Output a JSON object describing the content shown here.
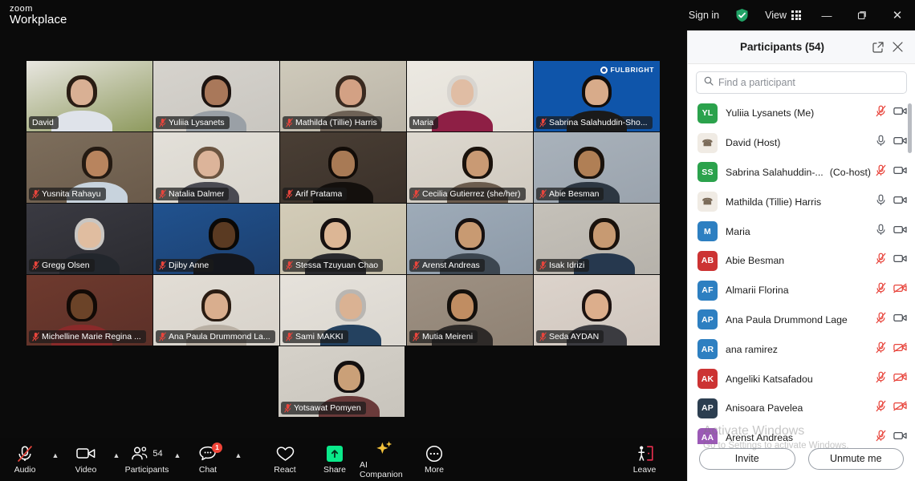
{
  "titlebar": {
    "brand_top": "zoom",
    "brand_bottom": "Workplace",
    "signin": "Sign in",
    "shield_icon": "shield-check-icon",
    "view_label": "View",
    "view_icon": "grid-icon",
    "minimize_icon": "minimize-icon",
    "restore_icon": "restore-icon",
    "close_icon": "close-icon"
  },
  "gallery": {
    "active_speaker": "David",
    "tiles": [
      {
        "name": "David",
        "muted": false,
        "active": true,
        "bg": "#8e9a5e",
        "wall": "#e8e6e0",
        "skin": "#d9b094",
        "hair": "#2a1d14",
        "shirt": "#dfe3ea",
        "chair": "#2b2b2b"
      },
      {
        "name": "Yuliia Lysanets",
        "muted": true,
        "bg": "#c9c6c0",
        "wall": "#d6d3cd",
        "skin": "#a9785a",
        "hair": "#1c1310",
        "shirt": "#9aa0a6",
        "chair": ""
      },
      {
        "name": "Mathilda (Tillie) Harris",
        "muted": true,
        "bg": "#b9b3a6",
        "wall": "#cfcabb",
        "skin": "#d3a184",
        "hair": "#3a2a20",
        "shirt": "#6e6256",
        "chair": ""
      },
      {
        "name": "Maria",
        "muted": false,
        "bg": "#e2ded6",
        "wall": "#ece9e2",
        "skin": "#e0bda4",
        "hair": "#d8d5d0",
        "shirt": "#8e1f45",
        "chair": "#2e2a28"
      },
      {
        "name": "Sabrina Salahuddin-Sho...",
        "muted": true,
        "watermark": "FULBRIGHT",
        "bg": "#0f55aa",
        "wall": "#0f55aa",
        "skin": "#d8ab8a",
        "hair": "#120d0a",
        "shirt": "#1a1a1a",
        "chair": ""
      },
      {
        "name": "Yusnita Rahayu",
        "muted": true,
        "bg": "#6a5a4a",
        "wall": "#7d6e5c",
        "skin": "#b8845e",
        "hair": "#241a12",
        "shirt": "#c8d3dd",
        "chair": ""
      },
      {
        "name": "Natalia Dalmer",
        "muted": true,
        "bg": "#d8d4cc",
        "wall": "#e3e0d9",
        "skin": "#dcb49a",
        "hair": "#6b5440",
        "shirt": "#4a4a52",
        "chair": ""
      },
      {
        "name": "Arif Pratama",
        "muted": true,
        "bg": "#3a3029",
        "wall": "#4a3f35",
        "skin": "#a87a55",
        "hair": "#120c08",
        "shirt": "#14100d",
        "chair": ""
      },
      {
        "name": "Cecilia Gutierrez (she/her)",
        "muted": true,
        "bg": "#cfc9bf",
        "wall": "#ddd8cf",
        "skin": "#c99a74",
        "hair": "#1a120c",
        "shirt": "#6b5c4e",
        "chair": ""
      },
      {
        "name": "Abie Besman",
        "muted": true,
        "bg": "#9aa3ad",
        "wall": "#a9b2bb",
        "skin": "#b07f55",
        "hair": "#1a120c",
        "shirt": "#2d3742",
        "chair": ""
      },
      {
        "name": "Gregg Olsen",
        "muted": true,
        "bg": "#2b2b30",
        "wall": "#3a3a42",
        "skin": "#e0bda0",
        "hair": "#c9c6c2",
        "shirt": "#22262c",
        "chair": ""
      },
      {
        "name": "Djiby Anne",
        "muted": true,
        "bg": "#1d3f6e",
        "wall": "#20528f",
        "skin": "#5a3a22",
        "hair": "#0a0806",
        "shirt": "#14161c",
        "chair": ""
      },
      {
        "name": "Stessa Tzuyuan Chao",
        "muted": true,
        "bg": "#c4bda8",
        "wall": "#d3ccb8",
        "skin": "#dcb695",
        "hair": "#161010",
        "shirt": "#2a2a2e",
        "chair": ""
      },
      {
        "name": "Arenst Andreas",
        "muted": true,
        "bg": "#8d9aa8",
        "wall": "#9eabb8",
        "skin": "#c89a72",
        "hair": "#161010",
        "shirt": "#3c4650",
        "chair": ""
      },
      {
        "name": "Isak Idrizi",
        "muted": true,
        "bg": "#b6b2ab",
        "wall": "#c5c1b9",
        "skin": "#c79a72",
        "hair": "#1a120c",
        "shirt": "#26384e",
        "chair": ""
      },
      {
        "name": "Michelline Marie Regina ...",
        "muted": true,
        "bg": "#5c3028",
        "wall": "#6e3a2e",
        "skin": "#6b4328",
        "hair": "#120a06",
        "shirt": "#8a2a2a",
        "chair": ""
      },
      {
        "name": "Ana Paula Drummond La...",
        "muted": true,
        "bg": "#d7d2ca",
        "wall": "#e2ddd5",
        "skin": "#d9ae8e",
        "hair": "#2a1c12",
        "shirt": "#b9b0a4",
        "chair": ""
      },
      {
        "name": "Sami MAKKI",
        "muted": true,
        "bg": "#dad6cf",
        "wall": "#e6e2db",
        "skin": "#dab293",
        "hair": "#b9b6b2",
        "shirt": "#24415f",
        "chair": ""
      },
      {
        "name": "Mutia Meireni",
        "muted": true,
        "bg": "#8f8274",
        "wall": "#9e9183",
        "skin": "#c08d62",
        "hair": "#14100c",
        "shirt": "#2e2a28",
        "chair": ""
      },
      {
        "name": "Seda AYDAN",
        "muted": true,
        "bg": "#cfc6be",
        "wall": "#dcd3cb",
        "skin": "#dcae8c",
        "hair": "#1c1210",
        "shirt": "#3b3b40",
        "chair": ""
      },
      {
        "name": "Yotsawat Pomyen",
        "muted": true,
        "bg": "#c8c4bc",
        "wall": "#d5d1c9",
        "skin": "#caa078",
        "hair": "#141010",
        "shirt": "#6a3a3a",
        "chair": ""
      }
    ]
  },
  "toolbar": {
    "items": [
      {
        "name": "audio",
        "label": "Audio",
        "icon": "microphone-muted-icon",
        "muted": true,
        "caret": true
      },
      {
        "name": "video",
        "label": "Video",
        "icon": "camera-icon",
        "caret": true
      },
      {
        "name": "participants",
        "label": "Participants",
        "icon": "participants-icon",
        "count": "54",
        "caret": true
      },
      {
        "name": "chat",
        "label": "Chat",
        "icon": "chat-icon",
        "badge": "1",
        "caret": true
      },
      {
        "name": "react",
        "label": "React",
        "icon": "heart-icon"
      },
      {
        "name": "share",
        "label": "Share",
        "icon": "share-screen-icon"
      },
      {
        "name": "ai-companion",
        "label": "AI Companion",
        "icon": "sparkles-icon"
      },
      {
        "name": "more",
        "label": "More",
        "icon": "ellipsis-icon"
      },
      {
        "name": "leave",
        "label": "Leave",
        "icon": "leave-door-icon"
      }
    ]
  },
  "participants_panel": {
    "title": "Participants (54)",
    "popout_icon": "popout-icon",
    "close_icon": "close-icon",
    "search_placeholder": "Find a participant",
    "search_value": "",
    "search_icon": "search-icon",
    "invite_label": "Invite",
    "unmute_label": "Unmute me",
    "rows": [
      {
        "initials": "YL",
        "color": "#2ba24c",
        "name": "Yuliia Lysanets (Me)",
        "role": "",
        "mic": "muted",
        "cam": "on"
      },
      {
        "initials": "",
        "color": "phone",
        "name": "David (Host)",
        "role": "",
        "mic": "on",
        "cam": "on"
      },
      {
        "initials": "SS",
        "color": "#2ba24c",
        "name": "Sabrina Salahuddin-...",
        "role": "(Co-host)",
        "mic": "muted",
        "cam": "on"
      },
      {
        "initials": "",
        "color": "phone",
        "name": "Mathilda (Tillie) Harris",
        "role": "",
        "mic": "on",
        "cam": "on"
      },
      {
        "initials": "M",
        "color": "#2d7fc1",
        "name": "Maria",
        "role": "",
        "mic": "on",
        "cam": "on"
      },
      {
        "initials": "AB",
        "color": "#cc3333",
        "name": "Abie Besman",
        "role": "",
        "mic": "muted",
        "cam": "on"
      },
      {
        "initials": "AF",
        "color": "#2d7fc1",
        "name": "Almarii Florina",
        "role": "",
        "mic": "muted",
        "cam": "off"
      },
      {
        "initials": "AP",
        "color": "#2d7fc1",
        "name": "Ana Paula Drummond Lage",
        "role": "",
        "mic": "muted",
        "cam": "on"
      },
      {
        "initials": "AR",
        "color": "#2d7fc1",
        "name": "ana ramirez",
        "role": "",
        "mic": "muted",
        "cam": "off"
      },
      {
        "initials": "AK",
        "color": "#cc3333",
        "name": "Angeliki Katsafadou",
        "role": "",
        "mic": "muted",
        "cam": "off"
      },
      {
        "initials": "AP",
        "color": "#2c3e50",
        "name": "Anisoara Pavelea",
        "role": "",
        "mic": "muted",
        "cam": "off"
      },
      {
        "initials": "AA",
        "color": "#9b59b6",
        "name": "Arenst Andreas",
        "role": "",
        "mic": "muted",
        "cam": "on"
      }
    ]
  },
  "watermark": {
    "line1": "Activate Windows",
    "line2": "Go to Settings to activate Windows."
  },
  "colors": {
    "accent_green": "#0ae98a",
    "active_border": "#3bd47a",
    "mute_red": "#e8453c",
    "badge_red": "#f04438",
    "leave_red": "#f05a5a"
  }
}
